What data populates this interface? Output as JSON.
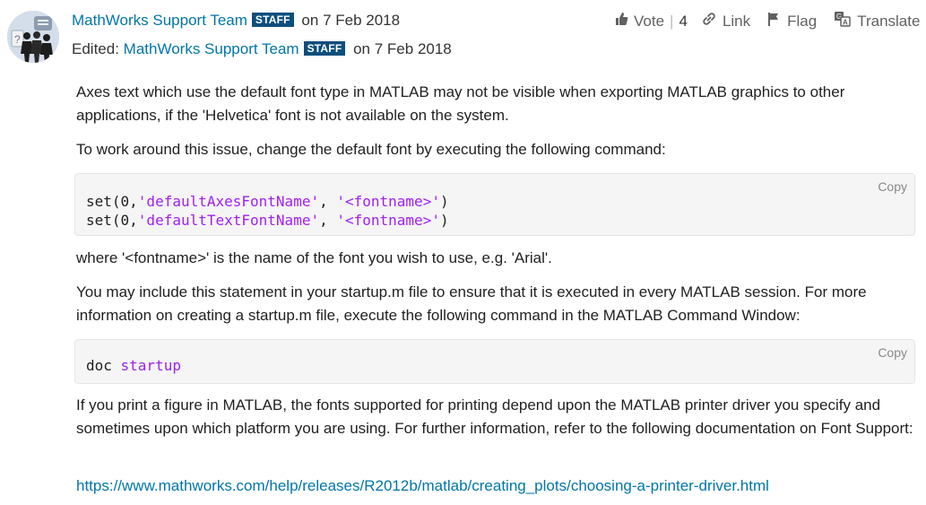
{
  "post": {
    "author": "MathWorks Support Team",
    "badge": "STAFF",
    "posted_prefix": "on",
    "posted_date": "7 Feb 2018",
    "edited_label": "Edited:",
    "edited_by": "MathWorks Support Team",
    "edited_prefix": "on",
    "edited_date": "7 Feb 2018"
  },
  "actions": {
    "vote_label": "Vote",
    "vote_count": "4",
    "link_label": "Link",
    "flag_label": "Flag",
    "translate_label": "Translate"
  },
  "body": {
    "p1": "Axes text which use the default font type in MATLAB may not be visible when exporting MATLAB graphics to other applications, if the 'Helvetica' font is not available on the system.",
    "p2": "To work around this issue, change the default font by executing the following command:",
    "code1": {
      "copy_label": "Copy",
      "line1_prefix": "set(0,",
      "line1_arg1": "'defaultAxesFontName'",
      "line1_sep": ", ",
      "line1_arg2": "'<fontname>'",
      "line1_suffix": ")",
      "line2_prefix": "set(0,",
      "line2_arg1": "'defaultTextFontName'",
      "line2_sep": ", ",
      "line2_arg2": "'<fontname>'",
      "line2_suffix": ")"
    },
    "p3": "where '<fontname>' is the name of the font you wish to use, e.g. 'Arial'.",
    "p4": "You may include this statement in your startup.m file to ensure that it is executed in every MATLAB session. For more information on creating a startup.m file, execute the following command in the MATLAB Command Window:",
    "code2": {
      "copy_label": "Copy",
      "cmd": "doc ",
      "arg": "startup"
    },
    "p5": "If you print a figure in MATLAB, the fonts supported for printing depend upon the MATLAB printer driver you specify and sometimes upon which platform you are using. For further information, refer to the following documentation on Font Support:",
    "link": "https://www.mathworks.com/help/releases/R2012b/matlab/creating_plots/choosing-a-printer-driver.html"
  },
  "colors": {
    "link": "#0076a8",
    "badge_bg": "#0d4e7c",
    "string_literal": "#a020f0",
    "code_bg": "#f5f5f5"
  },
  "icons": [
    "avatar-group",
    "thumbs-up-icon",
    "link-icon",
    "flag-icon",
    "translate-icon"
  ]
}
